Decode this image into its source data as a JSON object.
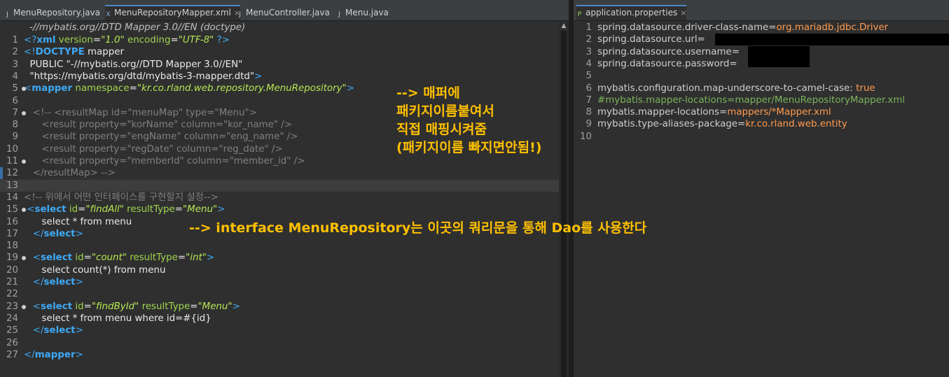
{
  "left_tabs": [
    {
      "label": "MenuRepository.java",
      "icon": "java-file-icon",
      "active": false
    },
    {
      "label": "MenuRepositoryMapper.xml",
      "icon": "xml-file-icon",
      "active": true,
      "close": "×"
    },
    {
      "label": "MenuController.java",
      "icon": "java-file-icon",
      "active": false
    },
    {
      "label": "Menu.java",
      "icon": "java-file-icon",
      "active": false
    }
  ],
  "right_tabs": [
    {
      "label": "application.properties",
      "icon": "properties-file-icon",
      "active": true,
      "close": "×"
    }
  ],
  "xml_header_line": "-//mybatis.org//DTD Mapper 3.0//EN (doctype)",
  "xml_lines": [
    {
      "n": "1",
      "parts": [
        [
          "tag",
          "<?"
        ],
        [
          "kw",
          "xml"
        ],
        [
          "str",
          " "
        ],
        [
          "attr",
          "version"
        ],
        [
          "str",
          "="
        ],
        [
          "val",
          "\"1.0\""
        ],
        [
          "str",
          " "
        ],
        [
          "attr",
          "encoding"
        ],
        [
          "str",
          "="
        ],
        [
          "val",
          "\"UTF-8\""
        ],
        [
          "str",
          " "
        ],
        [
          "tag",
          "?>"
        ]
      ]
    },
    {
      "n": "2",
      "parts": [
        [
          "tag",
          "<!"
        ],
        [
          "kw",
          "DOCTYPE"
        ],
        [
          "str",
          " mapper"
        ]
      ]
    },
    {
      "n": "3",
      "parts": [
        [
          "str",
          "  PUBLIC "
        ],
        [
          "str",
          "\"-//mybatis.org//DTD Mapper 3.0//EN\""
        ]
      ]
    },
    {
      "n": "4",
      "parts": [
        [
          "str",
          "  \"https://mybatis.org/dtd/mybatis-3-mapper.dtd\""
        ],
        [
          "tag",
          ">"
        ]
      ]
    },
    {
      "n": "5",
      "parts": [
        [
          "tag",
          "<"
        ],
        [
          "kw",
          "mapper"
        ],
        [
          "str",
          " "
        ],
        [
          "attr",
          "namespace"
        ],
        [
          "str",
          "="
        ],
        [
          "val",
          "\"kr.co.rland.web.repository.MenuRepository\""
        ],
        [
          "tag",
          ">"
        ]
      ]
    },
    {
      "n": "6",
      "parts": []
    },
    {
      "n": "7",
      "parts": [
        [
          "cmt",
          "   <!-- <resultMap id=\"menuMap\" type=\"Menu\">"
        ]
      ]
    },
    {
      "n": "8",
      "parts": [
        [
          "cmt",
          "      <result property=\"korName\" column=\"kor_name\" />"
        ]
      ]
    },
    {
      "n": "9",
      "parts": [
        [
          "cmt",
          "      <result property=\"engName\" column=\"eng_name\" />"
        ]
      ]
    },
    {
      "n": "10",
      "parts": [
        [
          "cmt",
          "      <result property=\"regDate\" column=\"reg_date\" />"
        ]
      ]
    },
    {
      "n": "11",
      "parts": [
        [
          "cmt",
          "      <result property=\"memberId\" column=\"member_id\" />"
        ]
      ]
    },
    {
      "n": "12",
      "parts": [
        [
          "cmt",
          "   </resultMap> -->"
        ]
      ]
    },
    {
      "n": "13",
      "parts": []
    },
    {
      "n": "14",
      "parts": [
        [
          "cmt",
          "<!-- 위에서 어떤 인터페이스를 구현할지 설정-->"
        ]
      ]
    },
    {
      "n": "15",
      "parts": [
        [
          "str",
          " "
        ],
        [
          "tag",
          "<"
        ],
        [
          "kw",
          "select"
        ],
        [
          "str",
          " "
        ],
        [
          "attr",
          "id"
        ],
        [
          "str",
          "="
        ],
        [
          "val",
          "\"findAll\""
        ],
        [
          "str",
          " "
        ],
        [
          "attr",
          "resultType"
        ],
        [
          "str",
          "="
        ],
        [
          "val",
          "\"Menu\""
        ],
        [
          "tag",
          ">"
        ]
      ]
    },
    {
      "n": "16",
      "parts": [
        [
          "str",
          "      select * from menu"
        ]
      ]
    },
    {
      "n": "17",
      "parts": [
        [
          "str",
          "   "
        ],
        [
          "tag",
          "</"
        ],
        [
          "kw",
          "select"
        ],
        [
          "tag",
          ">"
        ]
      ]
    },
    {
      "n": "18",
      "parts": []
    },
    {
      "n": "19",
      "parts": [
        [
          "str",
          "   "
        ],
        [
          "tag",
          "<"
        ],
        [
          "kw",
          "select"
        ],
        [
          "str",
          " "
        ],
        [
          "attr",
          "id"
        ],
        [
          "str",
          "="
        ],
        [
          "val",
          "\"count\""
        ],
        [
          "str",
          " "
        ],
        [
          "attr",
          "resultType"
        ],
        [
          "str",
          "="
        ],
        [
          "val",
          "\"int\""
        ],
        [
          "tag",
          ">"
        ]
      ]
    },
    {
      "n": "20",
      "parts": [
        [
          "str",
          "      select count(*) from menu"
        ]
      ]
    },
    {
      "n": "21",
      "parts": [
        [
          "str",
          "   "
        ],
        [
          "tag",
          "</"
        ],
        [
          "kw",
          "select"
        ],
        [
          "tag",
          ">"
        ]
      ]
    },
    {
      "n": "22",
      "parts": []
    },
    {
      "n": "23",
      "parts": [
        [
          "str",
          "   "
        ],
        [
          "tag",
          "<"
        ],
        [
          "kw",
          "select"
        ],
        [
          "str",
          " "
        ],
        [
          "attr",
          "id"
        ],
        [
          "str",
          "="
        ],
        [
          "val",
          "\"findById\""
        ],
        [
          "str",
          " "
        ],
        [
          "attr",
          "resultType"
        ],
        [
          "str",
          "="
        ],
        [
          "val",
          "\"Menu\""
        ],
        [
          "tag",
          ">"
        ]
      ]
    },
    {
      "n": "24",
      "parts": [
        [
          "str",
          "      select * from menu where id=#{id}"
        ]
      ]
    },
    {
      "n": "25",
      "parts": [
        [
          "str",
          "   "
        ],
        [
          "tag",
          "</"
        ],
        [
          "kw",
          "select"
        ],
        [
          "tag",
          ">"
        ]
      ]
    },
    {
      "n": "26",
      "parts": []
    },
    {
      "n": "27",
      "parts": [
        [
          "tag",
          "</"
        ],
        [
          "kw",
          "mapper"
        ],
        [
          "tag",
          ">"
        ]
      ]
    }
  ],
  "prop_lines": [
    {
      "n": "1",
      "parts": [
        [
          "key",
          "spring.datasource.driver-class-name"
        ],
        [
          "eq",
          "="
        ],
        [
          "org",
          "org.mariadb.jdbc.Driver"
        ]
      ]
    },
    {
      "n": "2",
      "parts": [
        [
          "key",
          "spring.datasource.url"
        ],
        [
          "eq",
          "="
        ]
      ]
    },
    {
      "n": "3",
      "parts": [
        [
          "key",
          "spring.datasource.username"
        ],
        [
          "eq",
          "="
        ]
      ]
    },
    {
      "n": "4",
      "parts": [
        [
          "key",
          "spring.datasource.password"
        ],
        [
          "eq",
          "="
        ]
      ]
    },
    {
      "n": "5",
      "parts": []
    },
    {
      "n": "6",
      "parts": [
        [
          "key",
          "mybatis.configuration.map-underscore-to-camel-case"
        ],
        [
          "eq",
          ": "
        ],
        [
          "org",
          "true"
        ]
      ]
    },
    {
      "n": "7",
      "parts": [
        [
          "green",
          "#mybatis.mapper-locations=mapper/MenuRepositoryMapper.xml"
        ]
      ]
    },
    {
      "n": "8",
      "parts": [
        [
          "key",
          "mybatis.mapper-locations"
        ],
        [
          "eq",
          "="
        ],
        [
          "org",
          "mappers/*Mapper.xml"
        ]
      ]
    },
    {
      "n": "9",
      "parts": [
        [
          "key",
          "mybatis.type-aliases-package"
        ],
        [
          "eq",
          "="
        ],
        [
          "org",
          "kr.co.rland.web.entity"
        ]
      ]
    },
    {
      "n": "10",
      "parts": []
    }
  ],
  "annotations": {
    "mapper_note": [
      "--> 매퍼에",
      "패키지이름붙여서",
      "직접 매핑시켜줌",
      "(패키지이름 빠지면안됨!)"
    ],
    "interface_note": "--> interface MenuRepository는 이곳의 쿼리문을 통해 Dao를 사용한다"
  },
  "scroll_up_arrow": "▲"
}
